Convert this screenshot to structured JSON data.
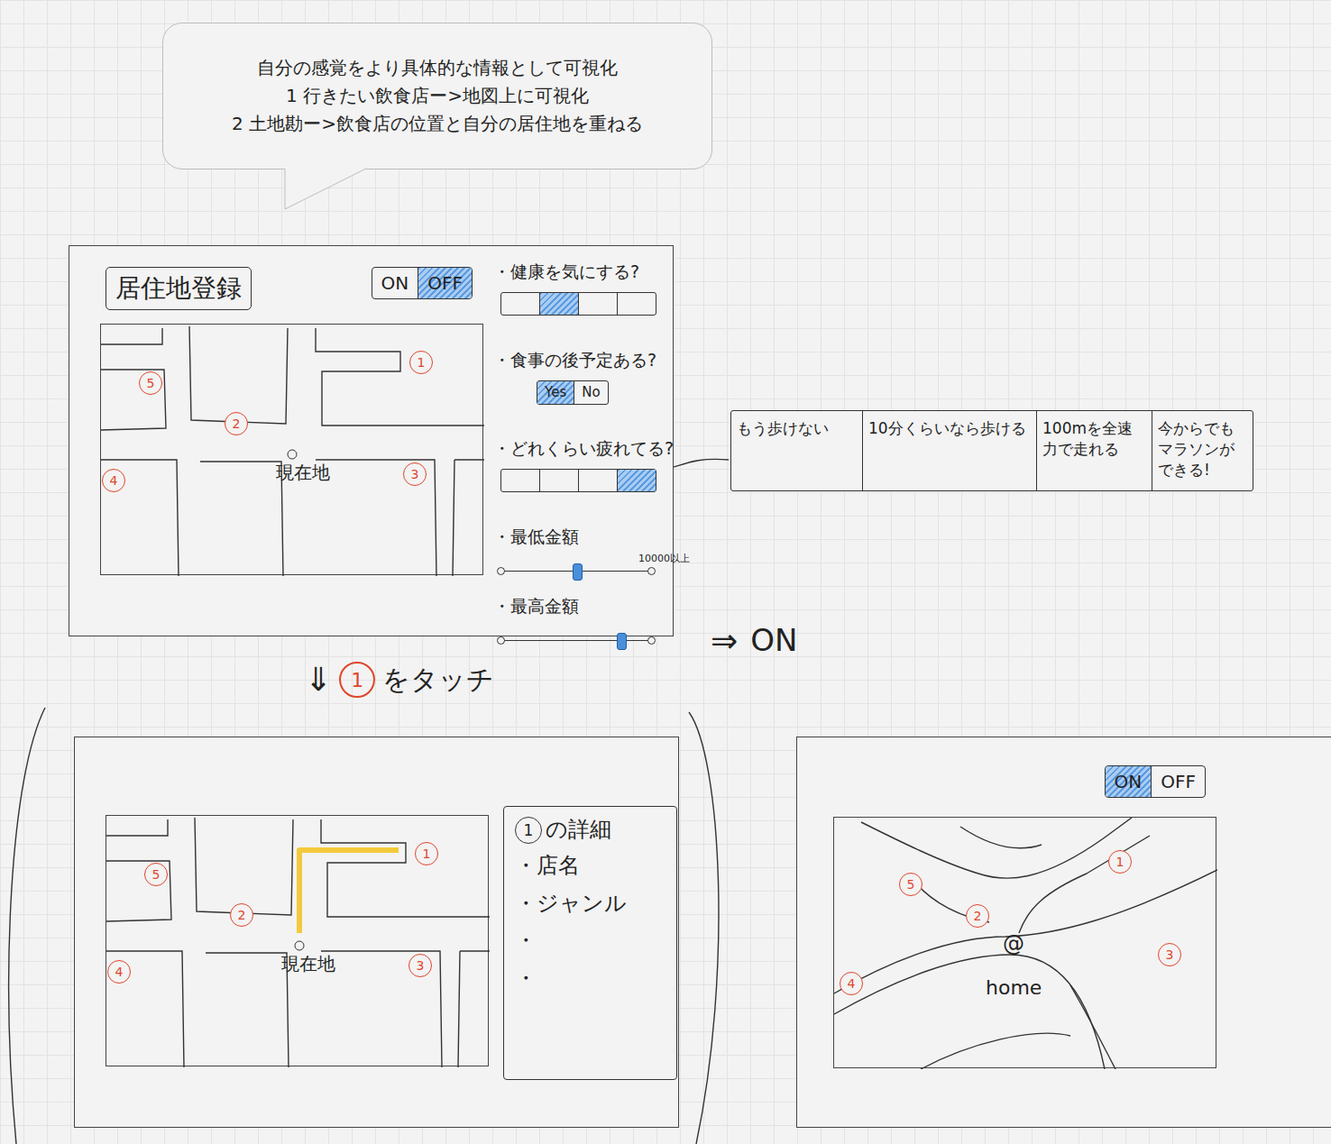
{
  "note": {
    "lines": [
      "自分の感覚をより具体的な情報として可視化",
      "1 行きたい飲食店ー>地図上に可視化",
      "2 土地勘ー>飲食店の位置と自分の居住地を重ねる"
    ]
  },
  "register_screen": {
    "title": "居住地登録",
    "toggle": [
      {
        "label": "ON",
        "selected": false
      },
      {
        "label": "OFF",
        "selected": true
      }
    ],
    "map": {
      "pins": [
        "1",
        "2",
        "3",
        "4",
        "5"
      ],
      "current_location": "現在地"
    },
    "questions": [
      {
        "kind": "segments",
        "label": "・健康を気にする?",
        "options": [
          {
            "selected": false
          },
          {
            "selected": true
          },
          {
            "selected": false
          },
          {
            "selected": false
          }
        ]
      },
      {
        "kind": "segments",
        "label": "・食事の後予定ある?",
        "options": [
          {
            "label": "Yes",
            "selected": true
          },
          {
            "label": "No",
            "selected": false
          }
        ]
      },
      {
        "kind": "segments",
        "label": "・どれくらい疲れてる?",
        "options": [
          {
            "selected": false
          },
          {
            "selected": false
          },
          {
            "selected": false
          },
          {
            "selected": true
          }
        ],
        "legend": [
          "もう歩けない",
          "10分くらいなら歩ける",
          "100mを全速力で走れる",
          "今からでもマラソンができる!"
        ]
      },
      {
        "kind": "slider",
        "label": "・最低金額",
        "level": 0.5,
        "max_label": "10000以上"
      },
      {
        "kind": "slider",
        "label": "・最高金額",
        "level": 0.8
      }
    ]
  },
  "transitions": [
    {
      "arrow": "⇓",
      "pin": "1",
      "text": "をタッチ"
    },
    {
      "arrow": "⇒",
      "text": "ON"
    }
  ],
  "detail_screen": {
    "map": {
      "pins": [
        "1",
        "2",
        "3",
        "4",
        "5"
      ],
      "current_location": "現在地",
      "route_to": "1"
    },
    "panel": {
      "title_pin": "1",
      "title": "の詳細",
      "items": [
        "・店名",
        "・ジャンル",
        "・",
        "・"
      ]
    }
  },
  "home_screen": {
    "toggle": [
      {
        "label": "ON",
        "selected": true
      },
      {
        "label": "OFF",
        "selected": false
      }
    ],
    "map": {
      "pins": [
        "1",
        "2",
        "3",
        "4",
        "5"
      ],
      "home_marker": "@",
      "home_label": "home"
    }
  }
}
